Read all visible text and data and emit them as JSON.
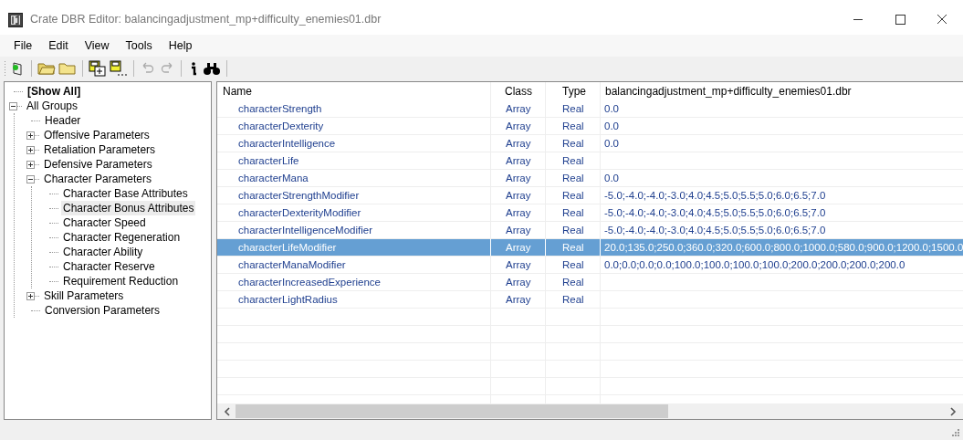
{
  "window": {
    "title": "Crate DBR Editor: balancingadjustment_mp+difficulty_enemies01.dbr"
  },
  "menu": [
    "File",
    "Edit",
    "View",
    "Tools",
    "Help"
  ],
  "tree": [
    {
      "label": "[Show All]",
      "kind": "leaf",
      "selected": false
    },
    {
      "label": "All Groups",
      "kind": "group",
      "expanded": true,
      "selected": false,
      "children": [
        {
          "label": "Header",
          "kind": "leaf",
          "selected": false
        },
        {
          "label": "Offensive Parameters",
          "kind": "group",
          "expanded": false,
          "selected": false
        },
        {
          "label": "Retaliation Parameters",
          "kind": "group",
          "expanded": false,
          "selected": false
        },
        {
          "label": "Defensive Parameters",
          "kind": "group",
          "expanded": false,
          "selected": false
        },
        {
          "label": "Character Parameters",
          "kind": "group",
          "expanded": true,
          "selected": false,
          "children": [
            {
              "label": "Character Base Attributes",
              "kind": "leaf",
              "selected": false
            },
            {
              "label": "Character Bonus Attributes",
              "kind": "leaf",
              "selected": true
            },
            {
              "label": "Character Speed",
              "kind": "leaf",
              "selected": false
            },
            {
              "label": "Character Regeneration",
              "kind": "leaf",
              "selected": false
            },
            {
              "label": "Character Ability",
              "kind": "leaf",
              "selected": false
            },
            {
              "label": "Character Reserve",
              "kind": "leaf",
              "selected": false
            },
            {
              "label": "Requirement Reduction",
              "kind": "leaf",
              "selected": false
            }
          ]
        },
        {
          "label": "Skill Parameters",
          "kind": "group",
          "expanded": false,
          "selected": false
        },
        {
          "label": "Conversion Parameters",
          "kind": "leaf",
          "selected": false
        }
      ]
    }
  ],
  "table": {
    "columns": [
      "Name",
      "Class",
      "Type",
      "balancingadjustment_mp+difficulty_enemies01.dbr"
    ],
    "rows": [
      {
        "name": "characterStrength",
        "class": "Array",
        "type": "Real",
        "value": "0.0",
        "selected": false
      },
      {
        "name": "characterDexterity",
        "class": "Array",
        "type": "Real",
        "value": "0.0",
        "selected": false
      },
      {
        "name": "characterIntelligence",
        "class": "Array",
        "type": "Real",
        "value": "0.0",
        "selected": false
      },
      {
        "name": "characterLife",
        "class": "Array",
        "type": "Real",
        "selected": false
      },
      {
        "name": "characterMana",
        "class": "Array",
        "type": "Real",
        "value": "0.0",
        "selected": false
      },
      {
        "name": "characterStrengthModifier",
        "class": "Array",
        "type": "Real",
        "value": "-5.0;-4.0;-4.0;-3.0;4.0;4.5;5.0;5.5;5.0;6.0;6.5;7.0",
        "selected": false
      },
      {
        "name": "characterDexterityModifier",
        "class": "Array",
        "type": "Real",
        "value": "-5.0;-4.0;-4.0;-3.0;4.0;4.5;5.0;5.5;5.0;6.0;6.5;7.0",
        "selected": false
      },
      {
        "name": "characterIntelligenceModifier",
        "class": "Array",
        "type": "Real",
        "value": "-5.0;-4.0;-4.0;-3.0;4.0;4.5;5.0;5.5;5.0;6.0;6.5;7.0",
        "selected": false
      },
      {
        "name": "characterLifeModifier",
        "class": "Array",
        "type": "Real",
        "value": "20.0;135.0;250.0;360.0;320.0;600.0;800.0;1000.0;580.0;900.0;1200.0;1500.0",
        "selected": true
      },
      {
        "name": "characterManaModifier",
        "class": "Array",
        "type": "Real",
        "value": "0.0;0.0;0.0;0.0;100.0;100.0;100.0;100.0;200.0;200.0;200.0;200.0",
        "selected": false
      },
      {
        "name": "characterIncreasedExperience",
        "class": "Array",
        "type": "Real",
        "selected": false
      },
      {
        "name": "characterLightRadius",
        "class": "Array",
        "type": "Real",
        "selected": false
      }
    ]
  }
}
